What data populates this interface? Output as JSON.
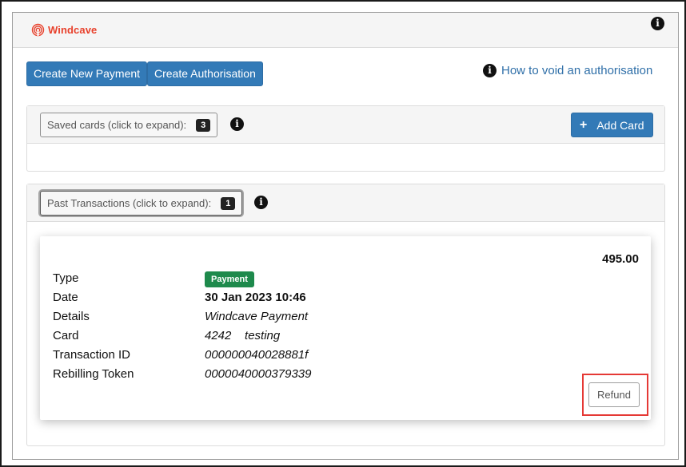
{
  "header": {
    "brand": "Windcave",
    "brand_icon": "windcave-fingerprint-icon",
    "info_icon": "info-icon"
  },
  "actions": {
    "create_payment_label": "Create New Payment",
    "create_authorisation_label": "Create Authorisation",
    "void_link_label": "How to void an authorisation"
  },
  "saved_cards": {
    "label": "Saved cards (click to expand):",
    "count": "3",
    "add_card_label": "Add Card"
  },
  "past_transactions": {
    "label": "Past Transactions (click to expand):",
    "count": "1"
  },
  "transaction": {
    "amount": "495.00",
    "type_label": "Type",
    "type_value": "Payment",
    "date_label": "Date",
    "date_value": "30 Jan 2023 10:46",
    "details_label": "Details",
    "details_value": "Windcave Payment",
    "card_label": "Card",
    "card_value": "4242    testing",
    "txn_id_label": "Transaction ID",
    "txn_id_value": "000000040028881f",
    "rebill_label": "Rebilling Token",
    "rebill_value": "0000040000379339",
    "refund_label": "Refund"
  },
  "colors": {
    "primary": "#337ab7",
    "brand": "#e8412c",
    "success": "#1e8a4c",
    "highlight": "#e53935",
    "link": "#2f6fa8"
  }
}
